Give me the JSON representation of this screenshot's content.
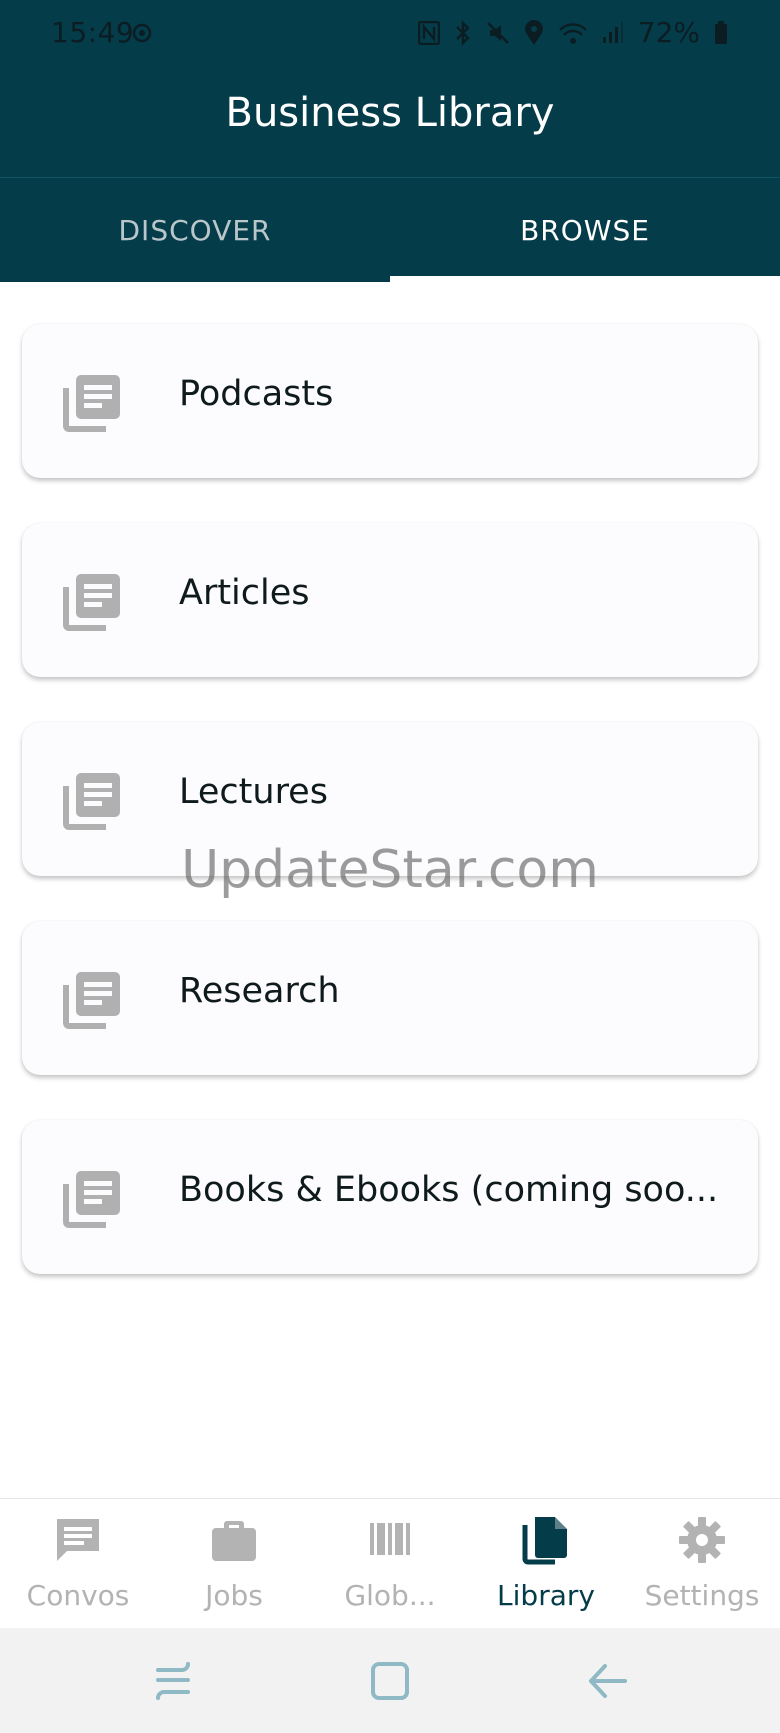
{
  "status_bar": {
    "time": "15:49",
    "battery": "72%"
  },
  "app_bar": {
    "title": "Business Library"
  },
  "tabs": [
    {
      "label": "DISCOVER",
      "active": false
    },
    {
      "label": "BROWSE",
      "active": true
    }
  ],
  "library_items": [
    {
      "label": "Podcasts",
      "icon": "library-books-icon"
    },
    {
      "label": "Articles",
      "icon": "library-books-icon"
    },
    {
      "label": "Lectures",
      "icon": "library-books-icon"
    },
    {
      "label": "Research",
      "icon": "library-books-icon"
    },
    {
      "label": "Books & Ebooks (coming soo...",
      "icon": "library-books-icon"
    }
  ],
  "watermark": "UpdateStar.com",
  "bottom_nav": [
    {
      "label": "Convos",
      "icon": "chat-icon",
      "active": false
    },
    {
      "label": "Jobs",
      "icon": "briefcase-icon",
      "active": false
    },
    {
      "label": "Glob...",
      "icon": "barcode-icon",
      "active": false
    },
    {
      "label": "Library",
      "icon": "library-icon",
      "active": true
    },
    {
      "label": "Settings",
      "icon": "gear-icon",
      "active": false
    }
  ],
  "colors": {
    "primary": "#053c4a",
    "inactive": "#b3b3b3",
    "card_bg": "#fcfbfd",
    "icon_gray": "#b0b0b0"
  }
}
